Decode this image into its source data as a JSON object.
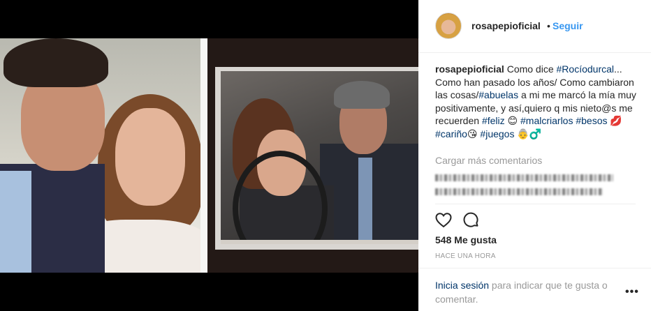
{
  "post": {
    "username": "rosapepioficial",
    "separator": "•",
    "follow_label": "Seguir",
    "caption": {
      "user": "rosapepioficial",
      "text_1": " Como dice ",
      "tag_1": "#Rocíodurcal",
      "text_2": "... Como han pasado los años/ Como cambiaron las cosas/",
      "tag_2": "#abuelas",
      "text_3": " a mi me marcó la mía muy positivamente, y así,quiero q mis nieto@s me recuerden ",
      "tag_3": "#feliz",
      "emoji_1": " 😊",
      "tag_4": "#malcriarlos",
      "tag_5": "#besos",
      "emoji_2": " 💋",
      "tag_6": "#cariño",
      "emoji_3": "😘",
      "tag_7": "#juegos",
      "emoji_4": " 👵‍♂"
    },
    "load_more_comments": "Cargar más comentarios",
    "likes": "548 Me gusta",
    "timestamp": "HACE UNA HORA",
    "login_link": "Inicia sesión",
    "login_text": " para indicar que te gusta o comentar.",
    "more_options": "•••"
  },
  "icons": {
    "like": "heart-icon",
    "comment": "comment-icon",
    "more": "more-options-icon"
  },
  "colors": {
    "link_blue": "#3897f0",
    "hashtag_blue": "#003569",
    "muted_text": "#999999",
    "primary_text": "#262626"
  }
}
